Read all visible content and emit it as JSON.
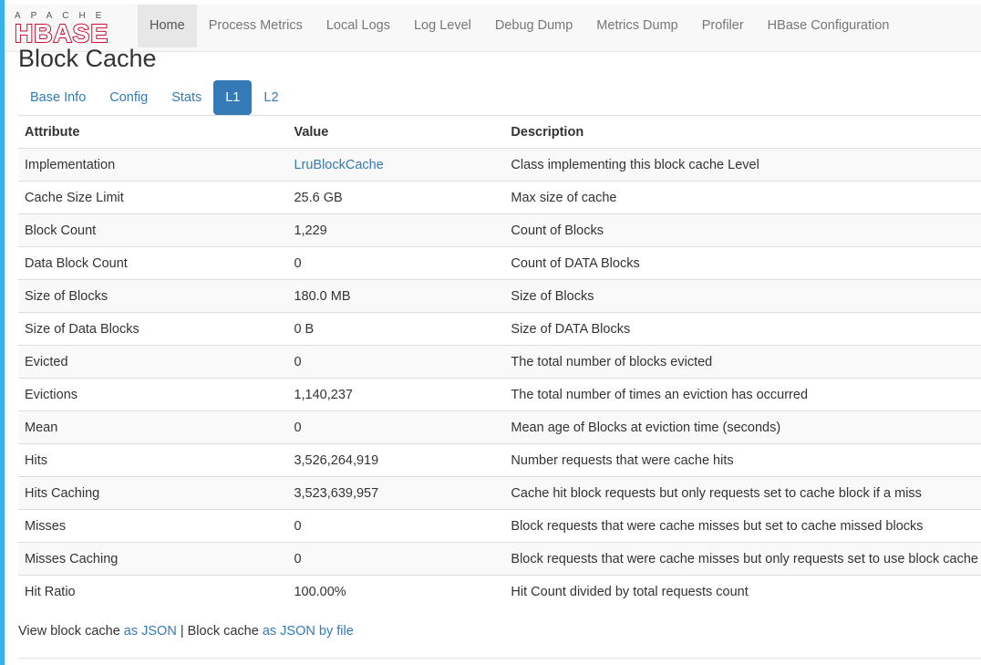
{
  "logo": {
    "top": "APACHE",
    "main": "HBASE"
  },
  "nav": [
    {
      "label": "Home",
      "active": true
    },
    {
      "label": "Process Metrics"
    },
    {
      "label": "Local Logs"
    },
    {
      "label": "Log Level"
    },
    {
      "label": "Debug Dump"
    },
    {
      "label": "Metrics Dump"
    },
    {
      "label": "Profiler"
    },
    {
      "label": "HBase Configuration"
    }
  ],
  "page_title": "Block Cache",
  "tabs": [
    {
      "label": "Base Info"
    },
    {
      "label": "Config"
    },
    {
      "label": "Stats"
    },
    {
      "label": "L1",
      "active": true
    },
    {
      "label": "L2"
    }
  ],
  "table": {
    "headers": [
      "Attribute",
      "Value",
      "Description"
    ],
    "rows": [
      {
        "attribute": "Implementation",
        "value": "LruBlockCache",
        "value_is_link": true,
        "description": "Class implementing this block cache Level"
      },
      {
        "attribute": "Cache Size Limit",
        "value": "25.6 GB",
        "description": "Max size of cache"
      },
      {
        "attribute": "Block Count",
        "value": "1,229",
        "description": "Count of Blocks"
      },
      {
        "attribute": "Data Block Count",
        "value": "0",
        "description": "Count of DATA Blocks"
      },
      {
        "attribute": "Size of Blocks",
        "value": "180.0 MB",
        "description": "Size of Blocks"
      },
      {
        "attribute": "Size of Data Blocks",
        "value": "0 B",
        "description": "Size of DATA Blocks"
      },
      {
        "attribute": "Evicted",
        "value": "0",
        "description": "The total number of blocks evicted"
      },
      {
        "attribute": "Evictions",
        "value": "1,140,237",
        "description": "The total number of times an eviction has occurred"
      },
      {
        "attribute": "Mean",
        "value": "0",
        "description": "Mean age of Blocks at eviction time (seconds)"
      },
      {
        "attribute": "Hits",
        "value": "3,526,264,919",
        "description": "Number requests that were cache hits"
      },
      {
        "attribute": "Hits Caching",
        "value": "3,523,639,957",
        "description": "Cache hit block requests but only requests set to cache block if a miss"
      },
      {
        "attribute": "Misses",
        "value": "0",
        "description": "Block requests that were cache misses but set to cache missed blocks"
      },
      {
        "attribute": "Misses Caching",
        "value": "0",
        "description": "Block requests that were cache misses but only requests set to use block cache"
      },
      {
        "attribute": "Hit Ratio",
        "value": "100.00%",
        "description": "Hit Count divided by total requests count"
      }
    ]
  },
  "footer": {
    "text1": "View block cache ",
    "link1": "as JSON",
    "sep": " | Block cache ",
    "link2": "as JSON by file"
  },
  "colors": {
    "link": "#337ab7",
    "accent": "#3ab0e8",
    "logo_red": "#c8102e"
  }
}
